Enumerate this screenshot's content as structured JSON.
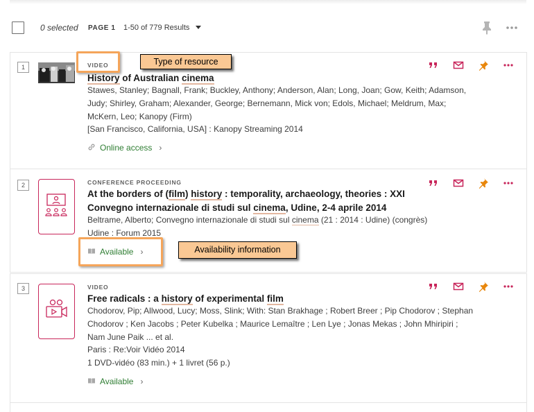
{
  "header": {
    "selected_count": "0 selected",
    "page_label": "PAGE 1",
    "results_range": "1-50 of 779 Results",
    "icons": [
      "pin-icon",
      "more-icon"
    ]
  },
  "results": [
    {
      "number": "1",
      "type": "VIDEO",
      "title_parts": [
        "History",
        " of Australian ",
        "cinema"
      ],
      "meta_lines": [
        "Stawes, Stanley; Bagnall, Frank; Buckley, Anthony; Anderson, Alan; Long, Joan; Gow, Keith; Adamson,",
        "Judy; Shirley, Graham; Alexander, George; Bernemann, Mick von; Edols, Michael; Meldrum, Max;",
        "McKern, Leo; Kanopy (Firm)",
        "[San Francisco, California, USA] : Kanopy Streaming 2014"
      ],
      "availability": "Online access",
      "availability_icon": "link-icon"
    },
    {
      "number": "2",
      "type": "CONFERENCE PROCEEDING",
      "title_line1_parts": [
        "At the borders of (",
        "film",
        ") ",
        "history",
        " : temporality, archaeology, theories : XXI"
      ],
      "title_line2_parts": [
        "Convegno internazionale di studi sul ",
        "cinema",
        ", Udine, 2-4 aprile 2014"
      ],
      "meta_line1_parts": [
        "Beltrame, Alberto; Convegno internazionale di studi sul ",
        "cinema",
        " (21 : 2014 : Udine) (congrès)"
      ],
      "meta_line2": "Udine : Forum 2015",
      "availability": "Available",
      "availability_icon": "book-icon"
    },
    {
      "number": "3",
      "type": "VIDEO",
      "title_parts": [
        "Free radicals : a ",
        "history",
        " of experimental ",
        "film"
      ],
      "meta_lines": [
        "Chodorov, Pip; Allwood, Lucy; Moss, Slink; With: Stan Brakhage ; Robert Breer ; Pip Chodorov ; Stephan",
        "Chodorov ; Ken Jacobs ; Peter Kubelka ; Maurice Lemaître ; Len Lye ; Jonas Mekas ; John Mhiripiri ;",
        "Nam June Paik ... et al.",
        "Paris : Re:Voir Vidéo 2014",
        "1 DVD-vidéo (83 min.) + 1 livret (56 p.)"
      ],
      "availability": "Available",
      "availability_icon": "book-icon"
    }
  ],
  "annotations": {
    "type_of_resource": "Type of resource",
    "availability_information": "Availability information"
  },
  "colors": {
    "accent": "#c8255a",
    "pin": "#e8860b",
    "available_green": "#2e7d32",
    "highlight_underline": "#e3b7a0",
    "callout_fill": "#fac894",
    "callout_border_box": "#f5a55a"
  }
}
